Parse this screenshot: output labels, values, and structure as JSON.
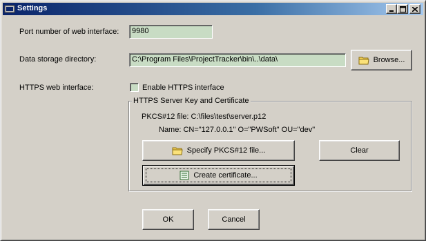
{
  "window": {
    "title": "Settings"
  },
  "titlebar": {
    "minimize_icon": "minimize-icon",
    "maximize_icon": "maximize-icon",
    "close_icon": "close-icon"
  },
  "port": {
    "label": "Port number of web interface:",
    "value": "9980"
  },
  "storage": {
    "label": "Data storage directory:",
    "value": "C:\\Program Files\\ProjectTracker\\bin\\..\\data\\",
    "browse_label": "Browse...",
    "browse_icon": "folder-icon"
  },
  "https": {
    "label": "HTTPS web interface:",
    "checkbox_label": "Enable HTTPS interface",
    "checked": false
  },
  "cert_group": {
    "title": "HTTPS Server Key and Certificate",
    "file_text": "PKCS#12 file: C:\\files\\test\\server.p12",
    "name_text": "Name: CN=\"127.0.0.1\" O=\"PWSoft\" OU=\"dev\"",
    "specify_label": "Specify PKCS#12 file...",
    "specify_icon": "folder-icon",
    "clear_label": "Clear",
    "create_label": "Create certificate...",
    "create_icon": "certificate-icon"
  },
  "dialog": {
    "ok_label": "OK",
    "cancel_label": "Cancel"
  },
  "colors": {
    "title_start": "#0a246a",
    "title_end": "#a6caf0",
    "field_bg": "#c8dcc4",
    "face": "#d4d0c8"
  }
}
